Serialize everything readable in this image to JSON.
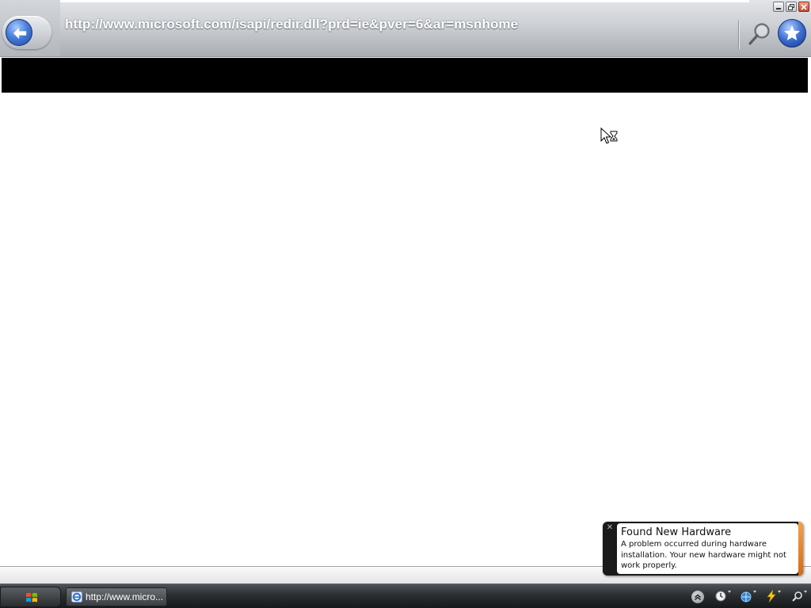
{
  "window": {
    "title": "http://www.microsoft.com/isapi/redir.dll?prd=ie&pver=6&ar=msnhome"
  },
  "toolbar": {
    "back_icon": "back-arrow-icon",
    "search_icon": "magnifier-icon",
    "favorites_icon": "star-icon",
    "address": "http://www.microsoft.com/isapi/redir.dll?prd=ie&pver=6&ar=msnhome"
  },
  "window_controls": {
    "minimize_icon": "minimize-icon",
    "restore_icon": "restore-icon",
    "close_icon": "close-icon"
  },
  "page": {
    "banner_color": "#000000",
    "cursor_icon": "busy-cursor-icon"
  },
  "notification": {
    "title": "Found New Hardware",
    "message": "A problem occurred during hardware installation. Your new hardware might not work properly.",
    "close_glyph": "✕",
    "accent_color": "#e8862a"
  },
  "taskbar": {
    "start_icon": "windows-logo-icon",
    "task_label": "http://www.micro...",
    "task_icon": "ie-icon",
    "tray": {
      "chevron_icon": "show-hidden-icons-icon",
      "icons": [
        "clock-icon",
        "network-icon",
        "power-icon",
        "search-icon"
      ]
    }
  },
  "colors": {
    "chrome": "#c3c6cb",
    "taskbar": "#2b2e31",
    "accent_blue": "#3c6fd0"
  }
}
